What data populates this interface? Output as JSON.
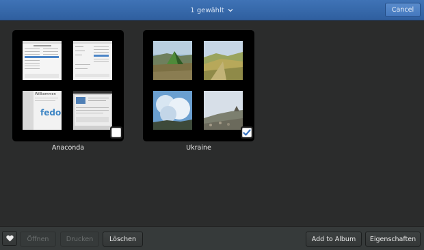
{
  "header": {
    "selection_title": "1 gewählt",
    "cancel_label": "Cancel"
  },
  "albums": [
    {
      "name": "Anaconda",
      "selected": false
    },
    {
      "name": "Ukraine",
      "selected": true
    }
  ],
  "thumbnail_text": {
    "welcome": "Willkommen",
    "brand": "fedora"
  },
  "toolbar": {
    "open_label": "Öffnen",
    "print_label": "Drucken",
    "delete_label": "Löschen",
    "add_to_album_label": "Add to Album",
    "properties_label": "Eigenschaften"
  },
  "colors": {
    "header": "#3a6db0",
    "accent_check": "#3873c0",
    "background": "#2b2c2c"
  }
}
